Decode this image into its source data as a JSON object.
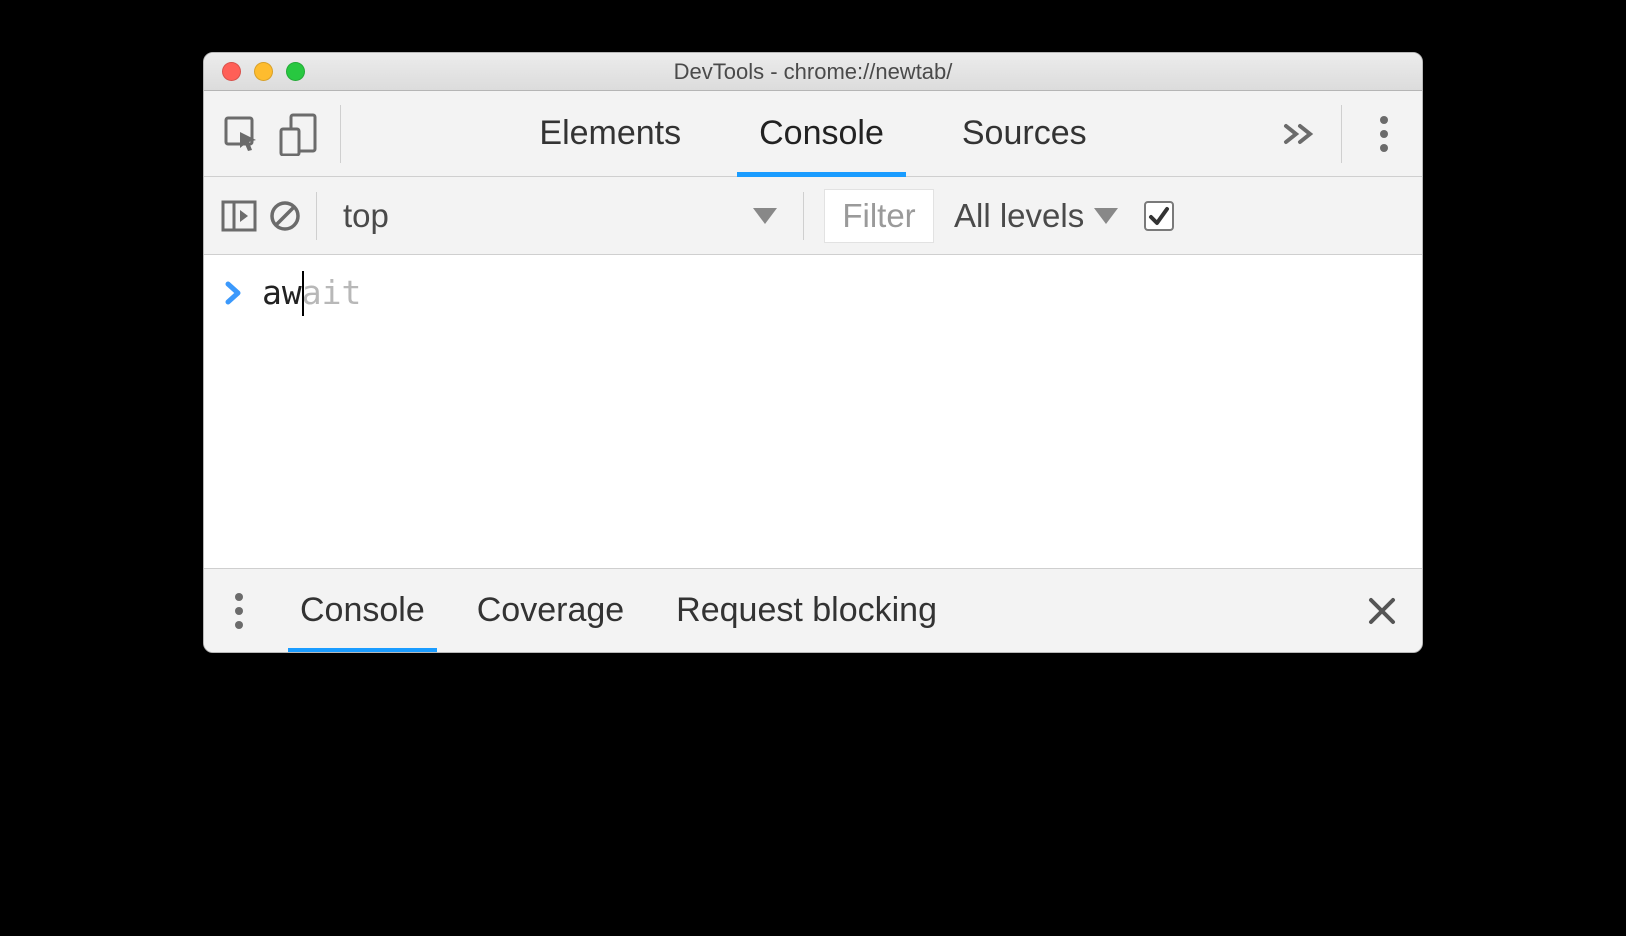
{
  "window": {
    "title": "DevTools - chrome://newtab/"
  },
  "tabs": {
    "elements": "Elements",
    "console": "Console",
    "sources": "Sources"
  },
  "filterbar": {
    "context": "top",
    "filter_placeholder": "Filter",
    "levels_label": "All levels"
  },
  "console": {
    "typed": "aw",
    "suggestion": "ait"
  },
  "drawer": {
    "console": "Console",
    "coverage": "Coverage",
    "request_blocking": "Request blocking"
  }
}
